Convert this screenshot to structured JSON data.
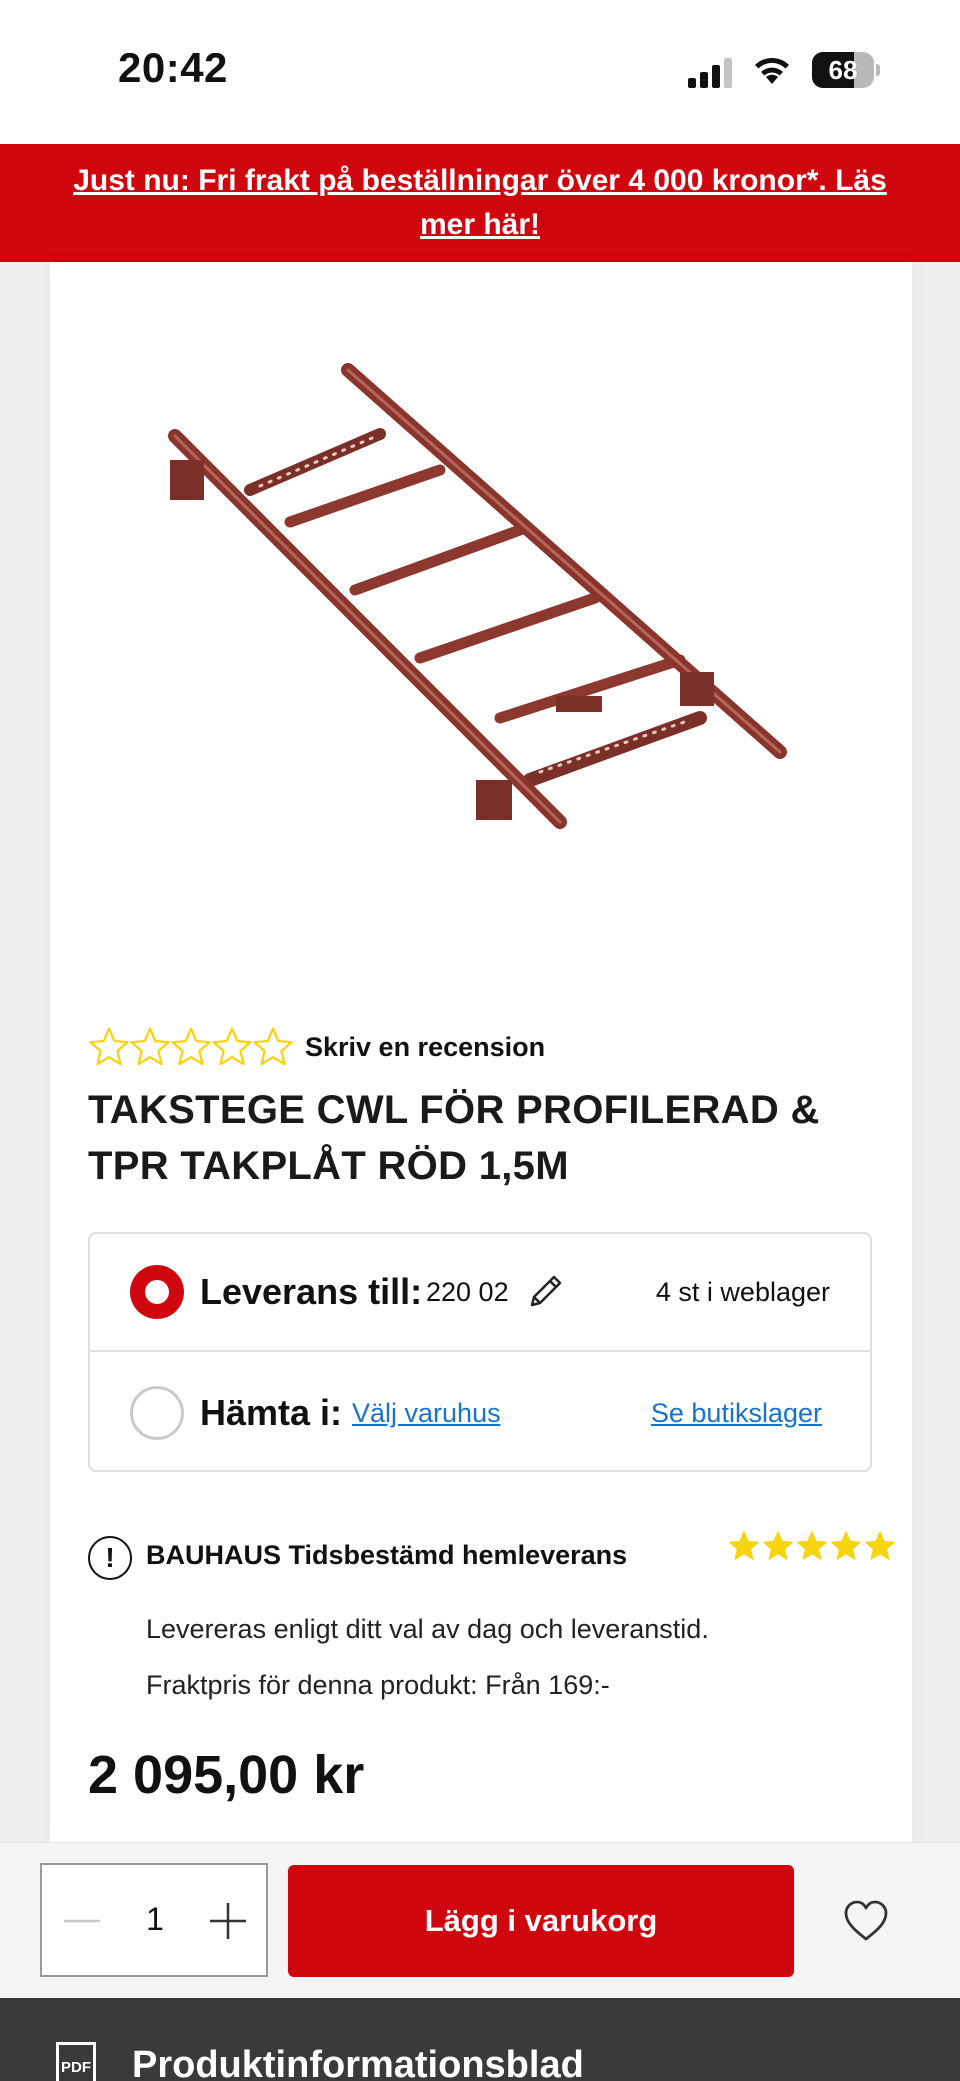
{
  "status_bar": {
    "time": "20:42",
    "battery": "68",
    "battery_level": 0.68,
    "icons": [
      "signal-icon",
      "wifi-icon",
      "battery-icon"
    ]
  },
  "promo": {
    "text": "Just nu: Fri frakt på beställningar över 4 000 kronor*. Läs mer här!"
  },
  "product": {
    "rating": {
      "value": 0,
      "max": 5,
      "icon": "star-outline-icon"
    },
    "review_link": "Skriv en recension",
    "title": "TAKSTEGE CWL FÖR PROFILERAD & TPR TAKPLÅT RÖD 1,5M",
    "price": "2 095,00 kr"
  },
  "delivery": {
    "ship": {
      "label": "Leverans till:",
      "zip": "220 02",
      "stock": "4 st i weblager",
      "selected": true
    },
    "pickup": {
      "label": "Hämta i:",
      "store_link": "Välj varuhus",
      "stock_link": "Se butikslager",
      "selected": false
    }
  },
  "service": {
    "title": "BAUHAUS Tidsbestämd hemleverans",
    "stars": 5,
    "description": "Levereras enligt ditt val av dag och leveranstid.",
    "freight": "Fraktpris för denna produkt: Från 169:-"
  },
  "cart": {
    "quantity": "1",
    "add_label": "Lägg i varukorg"
  },
  "pdf": {
    "icon_label": "PDF",
    "label": "Produktinformationsblad"
  },
  "colors": {
    "brand_red": "#d0060f",
    "link_blue": "#1a73c8",
    "star_yellow": "#f6d40f"
  }
}
